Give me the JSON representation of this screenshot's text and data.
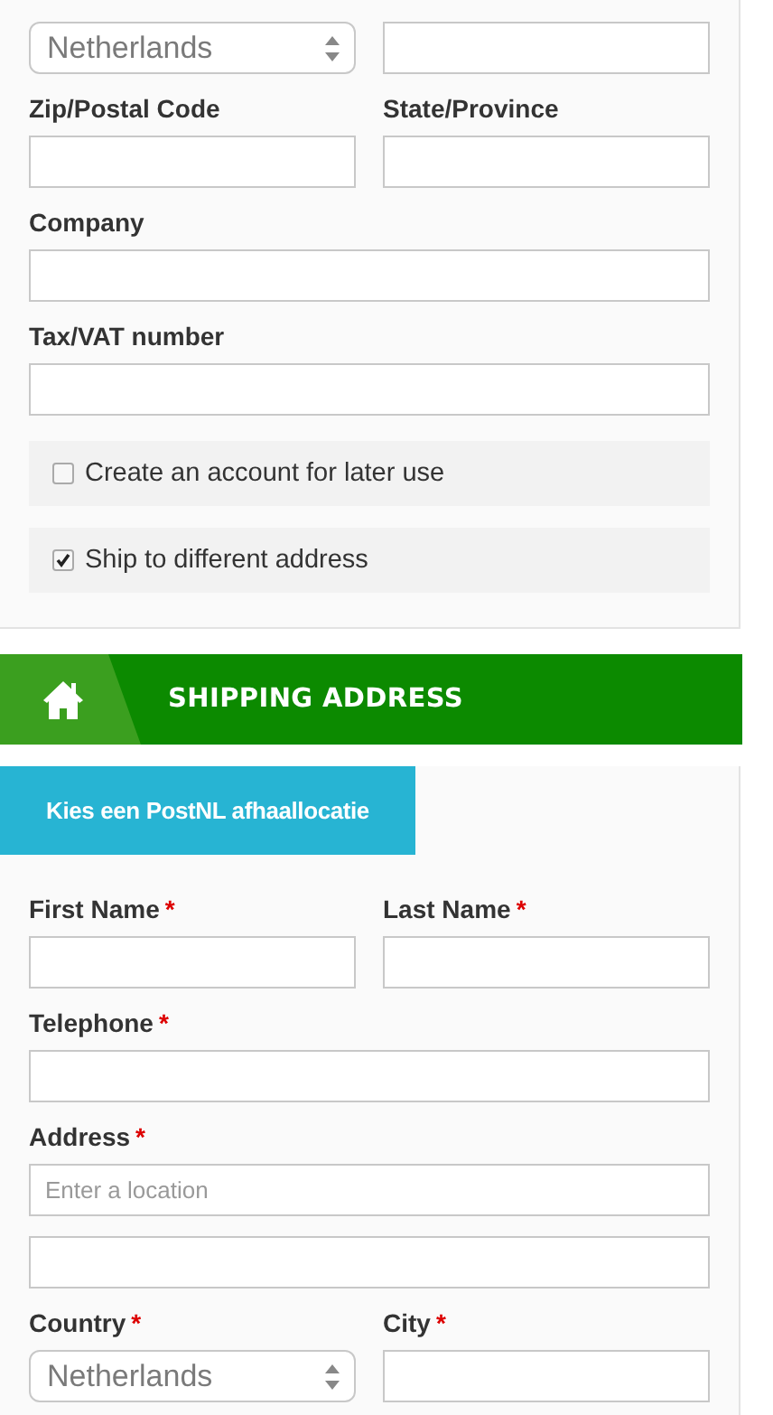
{
  "billing": {
    "rows": [
      [
        {
          "kind": "select",
          "value": "Netherlands"
        },
        {
          "kind": "text"
        }
      ],
      [
        {
          "kind": "text",
          "label": "Zip/Postal Code"
        },
        {
          "kind": "text",
          "label": "State/Province"
        }
      ],
      [
        {
          "kind": "text",
          "label": "Company"
        }
      ],
      [
        {
          "kind": "text",
          "label": "Tax/VAT number"
        }
      ]
    ],
    "options": [
      {
        "label": "Create an account for later use",
        "checked": false
      },
      {
        "label": "Ship to different address",
        "checked": true
      }
    ]
  },
  "shipping": {
    "header": {
      "title": "SHIPPING ADDRESS"
    },
    "pickup_button": {
      "label": "Kies een PostNL afhaallocatie"
    },
    "rows": [
      [
        {
          "kind": "text",
          "label": "First Name",
          "required_mark": "*"
        },
        {
          "kind": "text",
          "label": "Last Name",
          "required_mark": "*"
        }
      ],
      [
        {
          "kind": "text",
          "label": "Telephone",
          "required_mark": "*"
        }
      ],
      [
        {
          "kind": "text",
          "label": "Address",
          "required_mark": "*",
          "placeholder": "Enter a location"
        }
      ],
      [
        {
          "kind": "text"
        }
      ],
      [
        {
          "kind": "select",
          "label": "Country",
          "required_mark": "*",
          "value": "Netherlands"
        },
        {
          "kind": "text",
          "label": "City",
          "required_mark": "*"
        }
      ]
    ]
  }
}
